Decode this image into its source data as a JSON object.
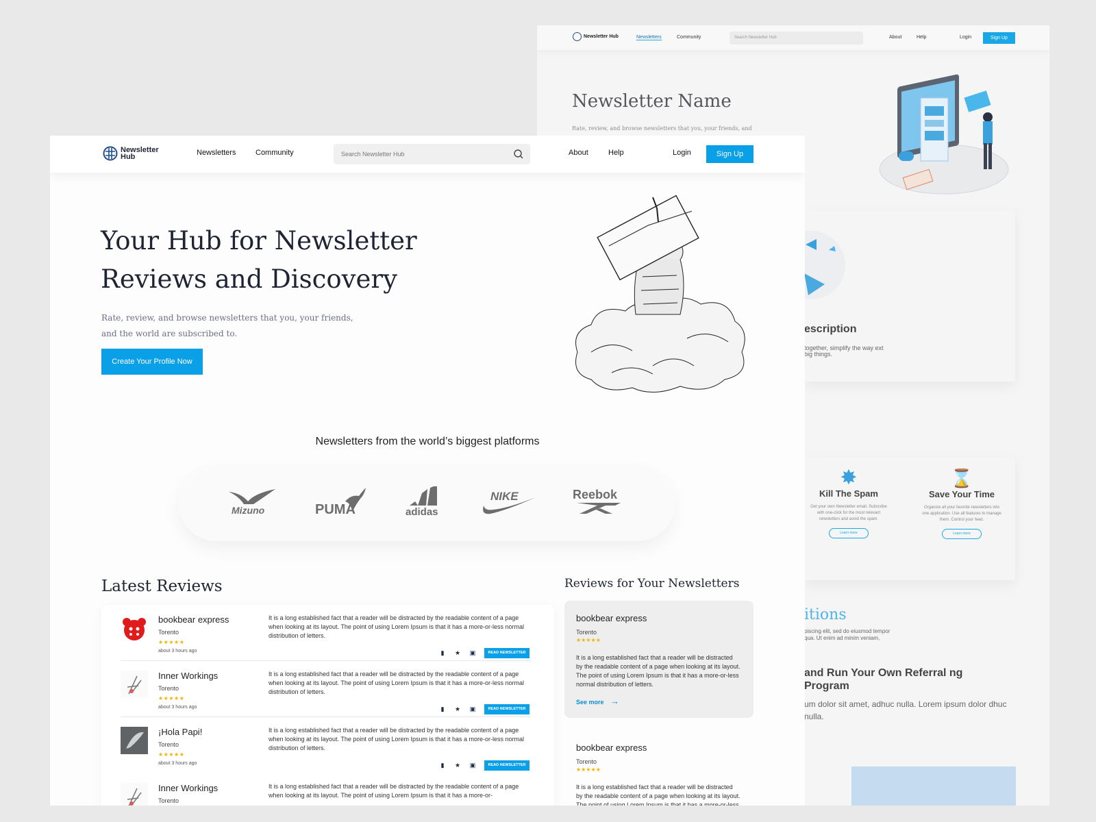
{
  "back": {
    "logo_text": "Newsletter Hub",
    "nav": [
      "Newsletters",
      "Community",
      "About",
      "Help",
      "Login"
    ],
    "search_placeholder": "Search Newsletter Hub",
    "signup": "Sign Up",
    "title": "Newsletter Name",
    "subtitle": "Rate, review, and browse newsletters that you, your friends, and",
    "card_heading": "escription",
    "card_text": "together, simplify the way ext big things.",
    "features": [
      {
        "title": "Kill The Spam",
        "text": "Get your own Newsletter email. Subscribe with one-click for the most relevant newsletters and avoid the spam.",
        "button": "Learn more"
      },
      {
        "title": "Save Your Time",
        "text": "Organize all your favorite newsletters into one application. Use all features to manage them. Control your feed.",
        "button": "Learn more"
      }
    ],
    "partial_blue": "itions",
    "partial_small": "piscing elit, sed do eiusmod tempor qua. Ut enim ad minim veniam,",
    "partial_heading": "and Run Your Own Referral ng Program",
    "partial_para": "um dolor sit amet, adhuc nulla.  Lorem ipsum dolor dhuc nulla."
  },
  "front": {
    "logo_line1": "Newsletter",
    "logo_line2": "Hub",
    "nav": {
      "newsletters": "Newsletters",
      "community": "Community",
      "about": "About",
      "help": "Help",
      "login": "Login",
      "signup": "Sign Up"
    },
    "search_placeholder": "Search Newsletter Hub",
    "hero_title": "Your Hub for Newsletter Reviews and Discovery",
    "hero_sub": "Rate, review, and browse newsletters that you, your friends, and the world are subscribed to.",
    "cta": "Create Your Profile Now",
    "platforms_title": "Newsletters from the world’s biggest platforms",
    "brands": [
      "Mizuno",
      "PUMA",
      "adidas",
      "NIKE",
      "Reebok"
    ],
    "latest_title": "Latest Reviews",
    "reviews": [
      {
        "name": "bookbear express",
        "location": "Torento",
        "stars": "★★★★★",
        "time": "about 3 hours ago",
        "text": "It is a long established fact that a reader will be distracted by the readable content of a page when looking at its layout. The point of using Lorem Ipsum is that it has a more-or-less normal distribution of letters.",
        "button": "READ NEWSLETTER"
      },
      {
        "name": "Inner Workings",
        "location": "Torento",
        "stars": "★★★★★",
        "time": "about 3 hours ago",
        "text": "It is a long established fact that a reader will be distracted by the readable content of a page when looking at its layout. The point of using Lorem Ipsum is that it has a more-or-less normal distribution of letters.",
        "button": "READ NEWSLETTER"
      },
      {
        "name": "¡Hola Papi!",
        "location": "Torento",
        "stars": "★★★★★",
        "time": "about 3 hours ago",
        "text": "It is a long established fact that a reader will be distracted by the readable content of a page when looking at its layout. The point of using Lorem Ipsum is that it has a more-or-less normal distribution of letters.",
        "button": "READ NEWSLETTER"
      },
      {
        "name": "Inner Workings",
        "location": "Torento",
        "stars": "",
        "time": "",
        "text": "It is a long established fact that a reader will be distracted by the readable content of a page when looking at its layout. The point of using Lorem Ipsum is that it has a more-or-",
        "button": ""
      }
    ],
    "yours_title": "Reviews for Your Newsletters",
    "your_reviews": [
      {
        "name": "bookbear express",
        "location": "Torento",
        "stars": "★★★★★",
        "text": "It is a long established fact that a reader will be distracted by the readable content of a page when looking at its layout. The point of using Lorem Ipsum is that it has a more-or-less normal distribution of letters.",
        "more": "See more"
      },
      {
        "name": "bookbear express",
        "location": "Torento",
        "stars": "★★★★★",
        "text": "It is a long established fact that a reader will be distracted by the readable content of a page when looking at its layout. The point of using Lorem Ipsum is that it has a more-or-less normal distribution of letters."
      }
    ]
  },
  "colors": {
    "accent": "#0aa0e8",
    "star": "#f0b400",
    "heading": "#1f2433"
  }
}
